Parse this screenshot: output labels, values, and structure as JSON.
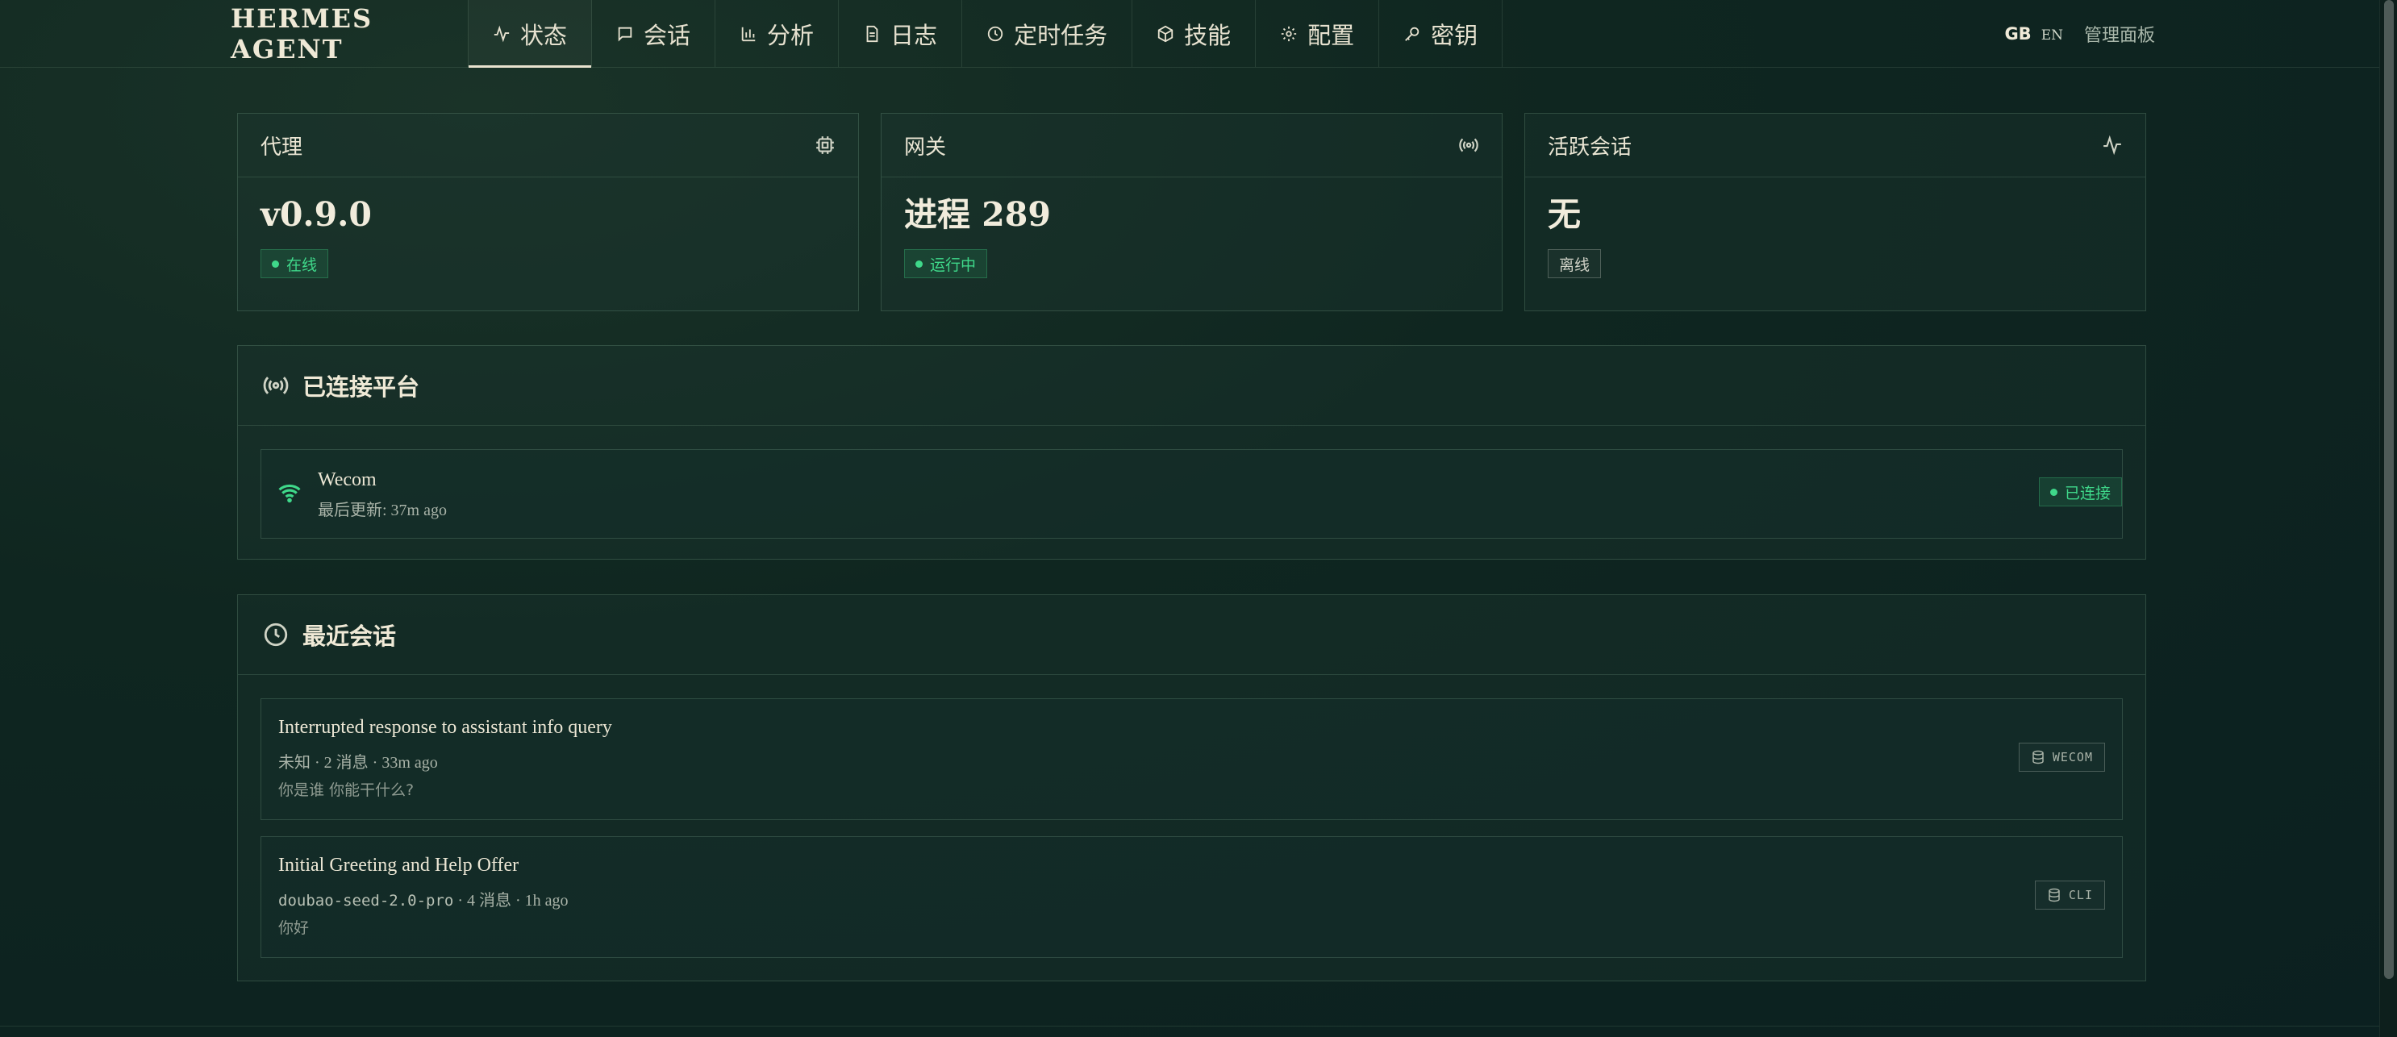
{
  "brand": "HERMES AGENT",
  "nav": {
    "items": [
      {
        "label": "状态",
        "icon": "activity-icon",
        "active": true
      },
      {
        "label": "会话",
        "icon": "chat-bubble-icon"
      },
      {
        "label": "分析",
        "icon": "bar-chart-icon"
      },
      {
        "label": "日志",
        "icon": "document-icon"
      },
      {
        "label": "定时任务",
        "icon": "clock-icon"
      },
      {
        "label": "技能",
        "icon": "package-icon"
      },
      {
        "label": "配置",
        "icon": "gear-icon"
      },
      {
        "label": "密钥",
        "icon": "key-icon"
      }
    ]
  },
  "top_right": {
    "lang_gb": "GB",
    "lang_en": "EN",
    "admin": "管理面板"
  },
  "stats": {
    "agent": {
      "title": "代理",
      "value": "v0.9.0",
      "badge": "在线",
      "icon": "cpu-icon"
    },
    "gateway": {
      "title": "网关",
      "value": "进程 289",
      "badge": "运行中",
      "icon": "radio-icon"
    },
    "sessions": {
      "title": "活跃会话",
      "value": "无",
      "badge": "离线",
      "icon": "activity-icon"
    }
  },
  "platforms": {
    "title": "已连接平台",
    "items": [
      {
        "name": "Wecom",
        "updated": "最后更新: 37m ago",
        "status": "已连接"
      }
    ]
  },
  "recent": {
    "title": "最近会话",
    "items": [
      {
        "title": "Interrupted response to assistant info query",
        "model": "未知",
        "meta": "· 2 消息 · 33m ago",
        "preview": "你是谁 你能干什么?",
        "source": "WECOM"
      },
      {
        "title": "Initial Greeting and Help Offer",
        "model": "doubao-seed-2.0-pro",
        "meta": "· 4 消息 · 1h ago",
        "preview": "你好",
        "source": "CLI"
      }
    ]
  },
  "colors": {
    "accent_green": "#3fd88a",
    "background": "#0f2620",
    "text": "#e8e4d4"
  }
}
